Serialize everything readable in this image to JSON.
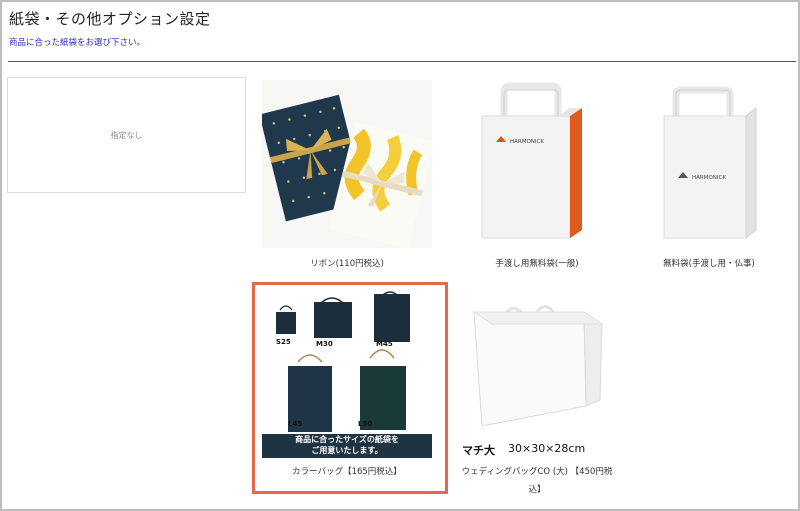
{
  "page": {
    "title": "紙袋・その他オプション設定",
    "subtitle": "商品に合った紙袋をお選び下さい。"
  },
  "options": {
    "none_label": "指定なし",
    "ribbon": {
      "caption": "リボン(110円税込)"
    },
    "free_bag_general": {
      "caption": "手渡し用無料袋(一般)",
      "logo": "HARMONICK"
    },
    "free_bag_buddhist": {
      "caption": "無料袋(手渡し用・仏事)",
      "logo": "HARMONICK"
    },
    "color_bag": {
      "caption": "カラーバッグ【165円税込】",
      "sizes": [
        "S25",
        "M30",
        "M45",
        "L45",
        "L50"
      ],
      "banner_line1": "商品に合ったサイズの紙袋を",
      "banner_line2": "ご用意いたします。",
      "selected": true
    },
    "wedding_bag": {
      "caption_line1": "ウェディングバッグCO (大) 【450円税",
      "caption_line2": "込】",
      "gusset_label": "マチ大",
      "dimensions": "30×30×28cm"
    }
  },
  "colors": {
    "selected_border": "#e26a4a",
    "subtitle_text": "#2a2acc",
    "navy_bag": "#1c2e3b",
    "banner_bg": "#1f3442",
    "ribbon_gold": "#c9a44a",
    "accent_orange": "#e05a1e"
  }
}
